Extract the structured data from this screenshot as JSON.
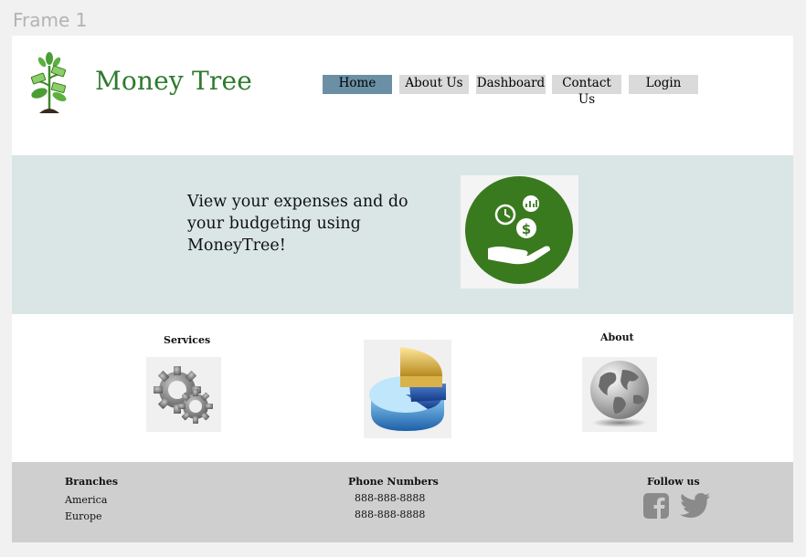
{
  "frame": {
    "label": "Frame 1"
  },
  "header": {
    "brand": "Money Tree",
    "logo_icon": "money-tree-icon",
    "nav": [
      {
        "label": "Home",
        "active": true
      },
      {
        "label": "About Us",
        "active": false
      },
      {
        "label": "Dashboard",
        "active": false
      },
      {
        "label": "Contact Us",
        "active": false
      },
      {
        "label": "Login",
        "active": false
      }
    ]
  },
  "hero": {
    "text": "View your expenses and do your budgeting using MoneyTree!",
    "image_icon": "hand-coins-icon",
    "image_color": "#3a7a1f"
  },
  "features": {
    "services_title": "Services",
    "services_icon": "gears-icon",
    "center_icon": "pie-chart-icon",
    "about_title": "About",
    "about_icon": "globe-icon"
  },
  "footer": {
    "branches_title": "Branches",
    "branches": [
      "America",
      "Europe"
    ],
    "phones_title": "Phone Numbers",
    "phones": [
      "888-888-8888",
      "888-888-8888"
    ],
    "follow_title": "Follow us",
    "social_icons": [
      "facebook-icon",
      "twitter-icon"
    ]
  },
  "colors": {
    "nav_active": "#6b90a6",
    "nav_default": "#dadada",
    "hero_bg": "#dae6e6",
    "footer_bg": "#cfcfcf",
    "brand": "#2e7a2e"
  }
}
